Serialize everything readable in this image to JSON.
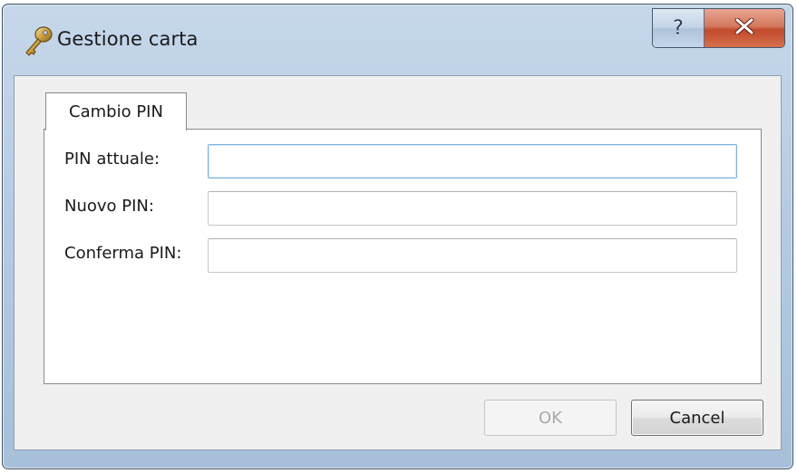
{
  "window": {
    "title": "Gestione carta",
    "help_label": "?",
    "icon": "key-icon",
    "close_icon": "close-icon"
  },
  "tabs": [
    {
      "label": "Cambio PIN",
      "selected": true
    }
  ],
  "form": {
    "current_pin": {
      "label": "PIN attuale:",
      "value": "",
      "focused": true
    },
    "new_pin": {
      "label": "Nuovo PIN:",
      "value": ""
    },
    "confirm_pin": {
      "label": "Conferma PIN:",
      "value": ""
    }
  },
  "buttons": {
    "ok_label": "OK",
    "ok_enabled": false,
    "cancel_label": "Cancel"
  },
  "colors": {
    "titlebar": "#b6cbe3",
    "close_button": "#c04a2b",
    "focus_border": "#7fb2dc",
    "disabled_text": "#a9a9a9"
  }
}
